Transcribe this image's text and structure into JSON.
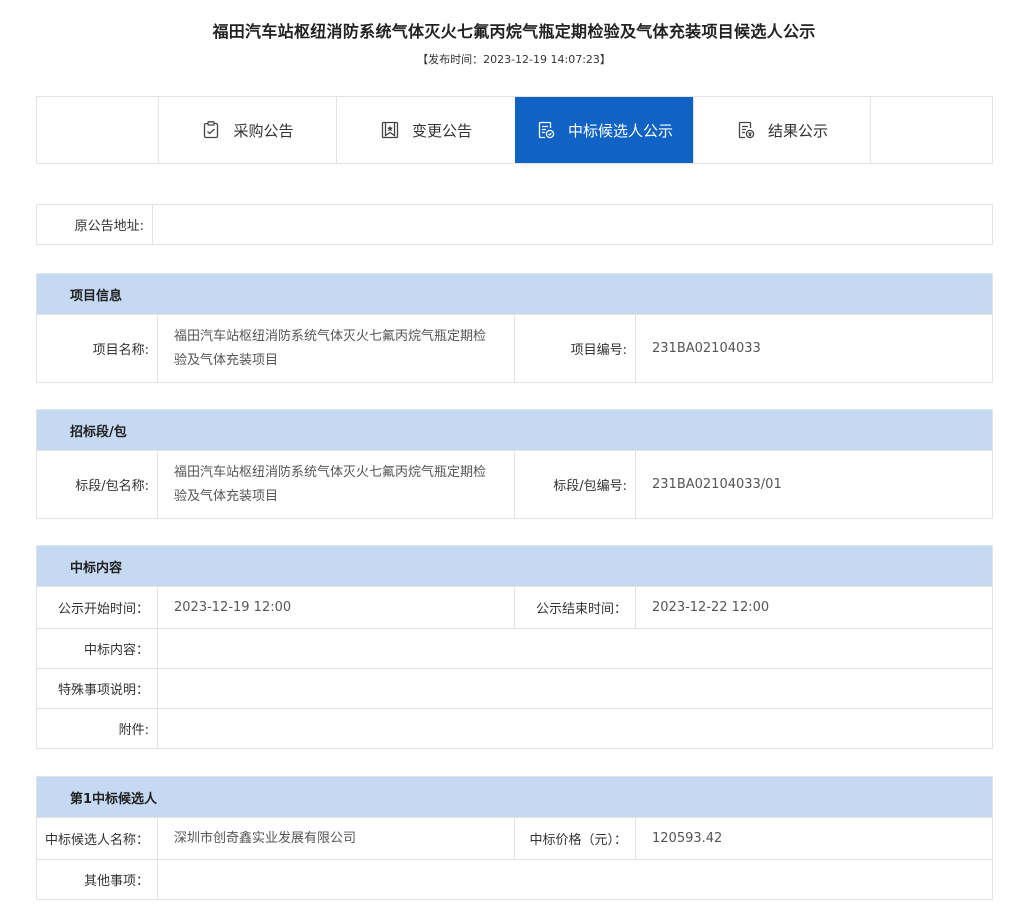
{
  "header": {
    "title": "福田汽车站枢纽消防系统气体灭火七氟丙烷气瓶定期检验及气体充装项目候选人公示",
    "publish_time": "【发布时间：2023-12-19 14:07:23】"
  },
  "tabs": [
    {
      "label": "采购公告",
      "icon": "clipboard-icon",
      "active": false
    },
    {
      "label": "变更公告",
      "icon": "bookmark-star-icon",
      "active": false
    },
    {
      "label": "中标候选人公示",
      "icon": "candidate-doc-icon",
      "active": true
    },
    {
      "label": "结果公示",
      "icon": "result-doc-icon",
      "active": false
    }
  ],
  "original": {
    "label": "原公告地址:",
    "value": ""
  },
  "project_info": {
    "header": "项目信息",
    "name_label": "项目名称:",
    "name_value": "福田汽车站枢纽消防系统气体灭火七氟丙烷气瓶定期检验及气体充装项目",
    "code_label": "项目编号:",
    "code_value": "231BA02104033"
  },
  "package": {
    "header": "招标段/包",
    "name_label": "标段/包名称:",
    "name_value": "福田汽车站枢纽消防系统气体灭火七氟丙烷气瓶定期检验及气体充装项目",
    "code_label": "标段/包编号:",
    "code_value": "231BA02104033/01"
  },
  "award": {
    "header": "中标内容",
    "start_label": "公示开始时间：",
    "start_value": "2023-12-19 12:00",
    "end_label": "公示结束时间：",
    "end_value": "2023-12-22 12:00",
    "content_label": "中标内容：",
    "content_value": "",
    "special_label": "特殊事项说明：",
    "special_value": "",
    "attachment_label": "附件:",
    "attachment_value": ""
  },
  "candidate": {
    "header": "第1中标候选人",
    "name_label": "中标候选人名称：",
    "name_value": "深圳市创奇鑫实业发展有限公司",
    "price_label": "中标价格（元）：",
    "price_value": "120593.42",
    "other_label": "其他事项：",
    "other_value": ""
  },
  "colors": {
    "active_tab": "#1062c4",
    "section_header": "#c5daf2",
    "border": "#e3e3e3"
  }
}
